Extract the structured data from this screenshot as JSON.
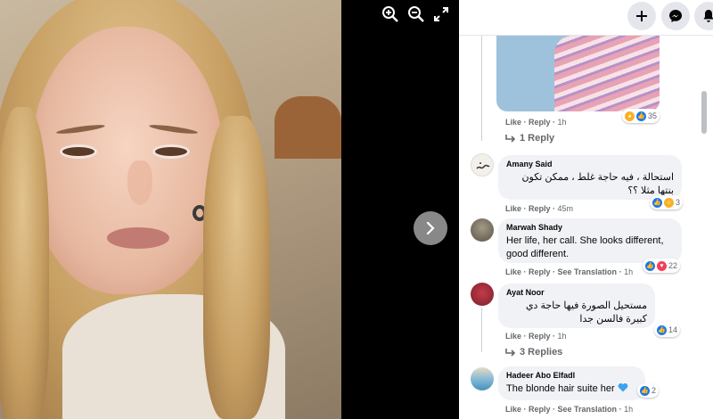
{
  "colors": {
    "link": "#65676b",
    "bubble": "#f0f2f5",
    "like_blue": "#1877f2",
    "love_red": "#f33e58",
    "heart_blue": "#3aa3ef"
  },
  "viewer": {
    "zoom_in_icon": "zoom-in-icon",
    "zoom_out_icon": "zoom-out-icon",
    "fullscreen_icon": "expand-icon",
    "next_icon": "chevron-right-icon"
  },
  "topbar": {
    "buttons": [
      "plus-icon",
      "messenger-icon",
      "bell-icon"
    ]
  },
  "first_post": {
    "like": "Like",
    "reply": "Reply",
    "time": "1h",
    "reaction_count": "35",
    "replies_label": "1 Reply"
  },
  "comments": [
    {
      "author": "Amany Said",
      "text": "استحالة ، فيه حاجة غلط ، ممكن تكون بنتها مثلا ؟؟",
      "like": "Like",
      "reply": "Reply",
      "time": "45m",
      "reactions": "3"
    },
    {
      "author": "Marwah Shady",
      "text": "Her life, her call. She looks different, good different.",
      "like": "Like",
      "reply": "Reply",
      "translation": "See Translation",
      "time": "1h",
      "reactions": "22"
    },
    {
      "author": "Ayat Noor",
      "text": "مستحيل الصورة فيها حاجة دي كبيرة فالسن جدا",
      "like": "Like",
      "reply": "Reply",
      "time": "1h",
      "reactions": "14",
      "replies_label": "3 Replies"
    },
    {
      "author": "Hadeer Abo Elfadl",
      "text": "The blonde hair suite her",
      "like": "Like",
      "reply": "Reply",
      "translation": "See Translation",
      "time": "1h",
      "reactions": "2"
    }
  ]
}
